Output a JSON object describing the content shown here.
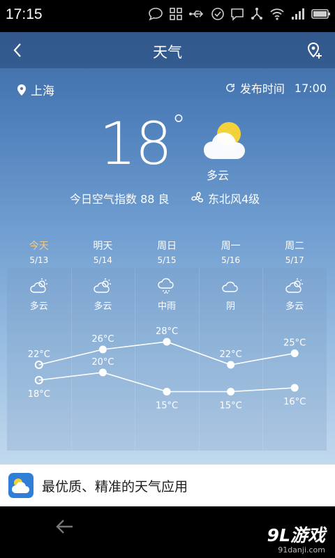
{
  "statusbar": {
    "time": "17:15"
  },
  "titlebar": {
    "title": "天气"
  },
  "location": {
    "name": "上海"
  },
  "publish": {
    "label": "发布时间",
    "time": "17:00"
  },
  "current": {
    "temperature": "18",
    "degree": "°",
    "condition": "多云",
    "aqi_text": "今日空气指数 88 良",
    "wind": "东北风4级"
  },
  "forecast": {
    "days": [
      {
        "name": "今天",
        "date": "5/13",
        "condition": "多云",
        "icon": "partly-cloudy-icon",
        "high": 22,
        "low": 18
      },
      {
        "name": "明天",
        "date": "5/14",
        "condition": "多云",
        "icon": "partly-cloudy-icon",
        "high": 26,
        "low": 20
      },
      {
        "name": "周日",
        "date": "5/15",
        "condition": "中雨",
        "icon": "rain-icon",
        "high": 28,
        "low": 15
      },
      {
        "name": "周一",
        "date": "5/16",
        "condition": "阴",
        "icon": "cloud-icon",
        "high": 22,
        "low": 15
      },
      {
        "name": "周二",
        "date": "5/17",
        "condition": "多云",
        "icon": "partly-cloudy-icon",
        "high": 25,
        "low": 16
      }
    ],
    "unit": "°C"
  },
  "banner": {
    "text": "最优质、精准的天气应用"
  },
  "watermark": {
    "brand": "9L游戏",
    "site": "91danji.com"
  },
  "colors": {
    "today_accent": "#f4c98a",
    "sun": "#f2d13a"
  }
}
